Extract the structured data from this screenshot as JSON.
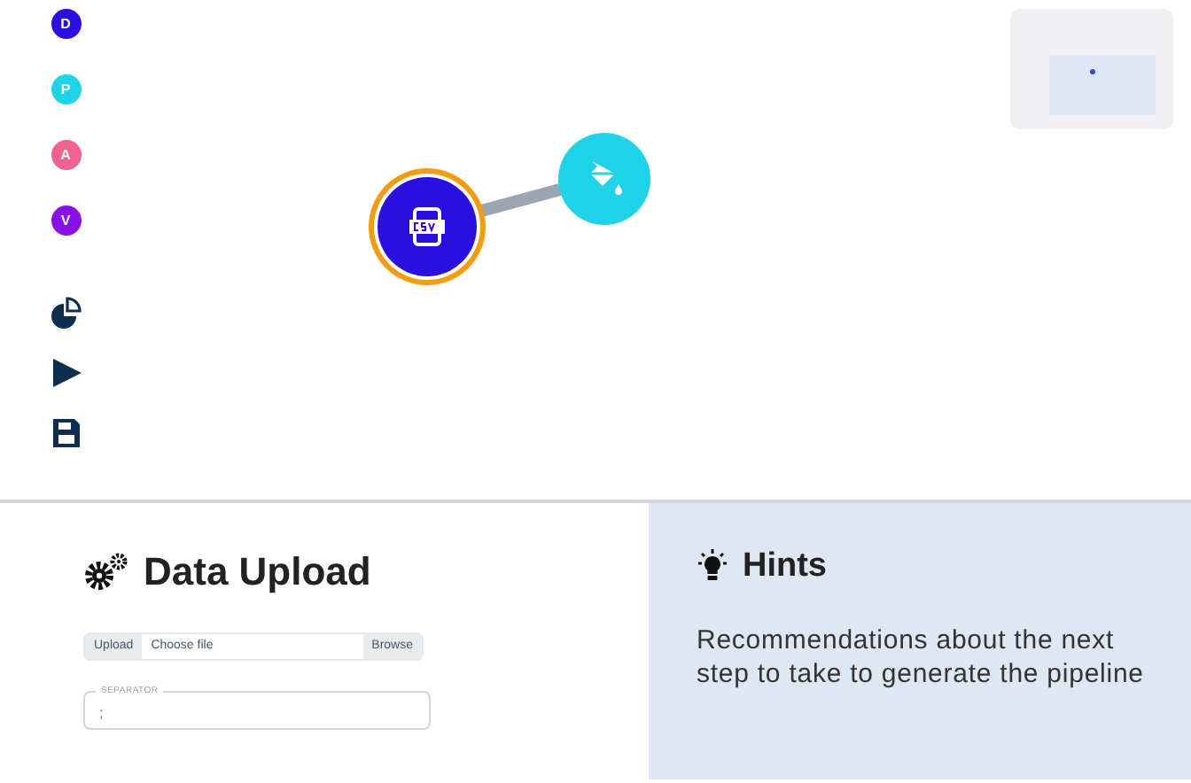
{
  "sidebar": {
    "steps": [
      {
        "letter": "D",
        "color": "#2a0fe0"
      },
      {
        "letter": "P",
        "color": "#1ed3e8"
      },
      {
        "letter": "A",
        "color": "#f0628f"
      },
      {
        "letter": "V",
        "color": "#8a10e8"
      }
    ],
    "tools": [
      {
        "kind": "chart"
      },
      {
        "kind": "run"
      },
      {
        "kind": "save"
      }
    ]
  },
  "canvas": {
    "nodes": [
      {
        "kind": "csv",
        "color": "#2a0fe0",
        "selected": true
      },
      {
        "kind": "paint",
        "color": "#1ed3e8",
        "selected": false
      }
    ]
  },
  "upload_panel": {
    "title": "Data Upload",
    "file_input": {
      "label": "Upload",
      "placeholder": "Choose file",
      "button": "Browse"
    },
    "separator": {
      "label": "SEPARATOR",
      "value": ";"
    }
  },
  "hints_panel": {
    "title": "Hints",
    "text": "Recommendations about the next step to take to generate the pipeline"
  }
}
